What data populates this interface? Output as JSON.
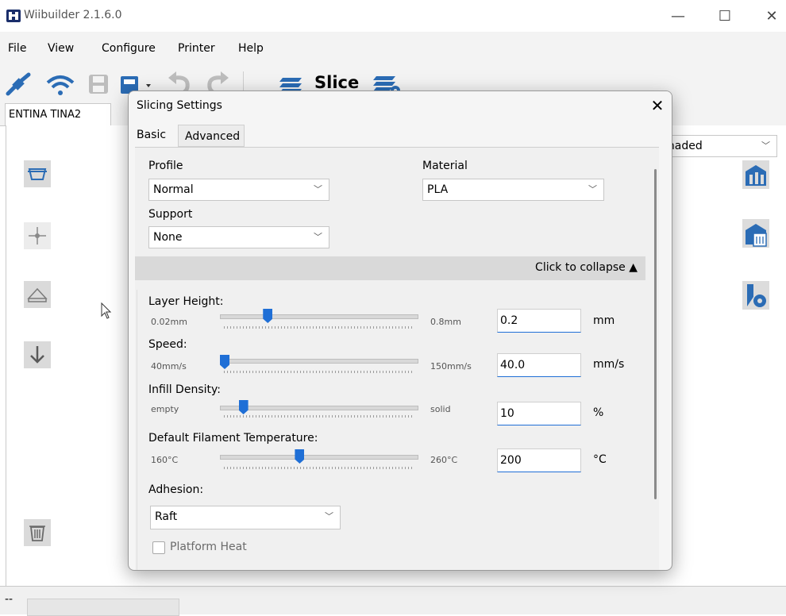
{
  "window": {
    "title": "Wiibuilder 2.1.6.0",
    "minimize": "—",
    "maximize": "☐",
    "close": "✕"
  },
  "menu": {
    "items": [
      "File",
      "View",
      "Configure",
      "Printer",
      "Help"
    ]
  },
  "toolbar": {
    "slice_label": "Slice"
  },
  "tabs": {
    "main": "ENTINA TINA2"
  },
  "view_mode": {
    "value": "Shaded"
  },
  "dialog": {
    "title": "Slicing Settings",
    "close": "✕",
    "tabs": [
      "Basic",
      "Advanced"
    ],
    "profile": {
      "label": "Profile",
      "value": "Normal"
    },
    "material": {
      "label": "Material",
      "value": "PLA"
    },
    "support": {
      "label": "Support",
      "value": "None"
    },
    "collapse_label": "Click to collapse ▲",
    "settings": [
      {
        "label": "Layer Height:",
        "min": "0.02mm",
        "max": "0.8mm",
        "value": "0.2",
        "unit": "mm",
        "fraction": 0.23
      },
      {
        "label": "Speed:",
        "min": "40mm/s",
        "max": "150mm/s",
        "value": "40.0",
        "unit": "mm/s",
        "fraction": 0.0
      },
      {
        "label": "Infill Density:",
        "min": "empty",
        "max": "solid",
        "value": "10",
        "unit": "%",
        "fraction": 0.1
      },
      {
        "label": "Default Filament Temperature:",
        "min": "160°C",
        "max": "260°C",
        "value": "200",
        "unit": "°C",
        "fraction": 0.4
      }
    ],
    "adhesion": {
      "label": "Adhesion:",
      "value": "Raft"
    },
    "platform_heat": {
      "label": "Platform Heat",
      "checked": false
    }
  },
  "statusbar": {
    "text": "--"
  },
  "colors": {
    "accent": "#1f6fd6",
    "icon_blue": "#2b6cb5",
    "icon_grey": "#8a8a8a"
  },
  "icons": [
    "app-logo-icon",
    "connect-icon",
    "wifi-icon",
    "save-icon",
    "open-file-icon",
    "undo-icon",
    "redo-icon",
    "slice-icon",
    "slice-settings-icon",
    "view-top-icon",
    "view-center-icon",
    "view-perspective-icon",
    "move-down-icon",
    "delete-icon",
    "rotate-icon",
    "mirror-icon",
    "gear-icon"
  ]
}
